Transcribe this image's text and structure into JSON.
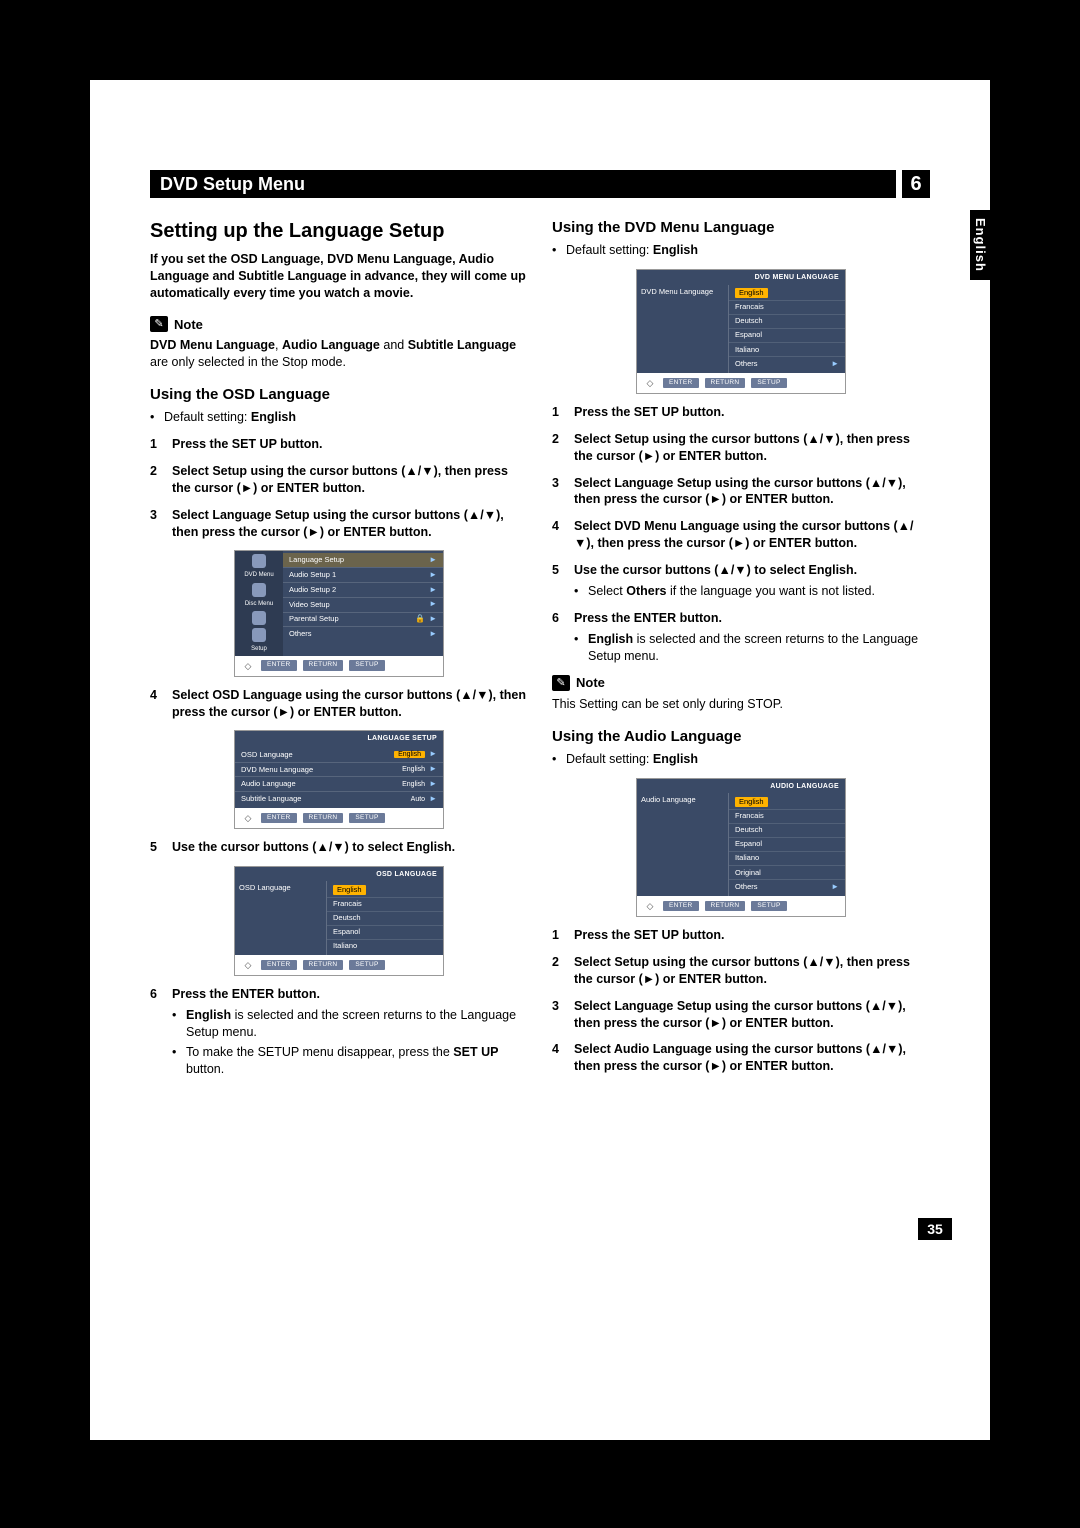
{
  "header": {
    "title": "DVD Setup Menu",
    "chapter": "6"
  },
  "side_tab": "English",
  "page_number": "35",
  "left": {
    "h2": "Setting up the Language Setup",
    "intro": "If you set the OSD Language, DVD Menu Language, Audio Language and Subtitle Language in advance, they will come up automatically every time you watch a movie.",
    "note_label": "Note",
    "note_text_pre": "DVD Menu Language",
    "note_text_mid1": ", ",
    "note_text_b2": "Audio Language",
    "note_text_mid2": " and ",
    "note_text_b3": "Subtitle Language",
    "note_text_post": " are only selected in the Stop mode.",
    "h3_osd": "Using the OSD Language",
    "default_label": "Default setting: ",
    "default_value": "English",
    "steps_osd": {
      "s1": "Press the SET UP button.",
      "s2a": "Select ",
      "s2b": "Setup",
      "s2c": " using the cursor buttons (▲/▼), then press the cursor (►) or ENTER button.",
      "s3a": "Select ",
      "s3b": "Language Setup",
      "s3c": " using the cursor buttons (▲/▼), then press the cursor (►) or ENTER button.",
      "s4a": "Select ",
      "s4b": "OSD Language",
      "s4c": " using the cursor buttons (▲/▼), then press the cursor (►) or ENTER button.",
      "s5a": "Use the cursor buttons (▲/▼) to select ",
      "s5b": "English",
      "s5c": ".",
      "s6": "Press the ENTER button.",
      "s6_b1a": "English",
      "s6_b1b": " is selected and the screen returns to the Language Setup menu.",
      "s6_b2a": "To make the SETUP menu disappear, press the ",
      "s6_b2b": "SET UP",
      "s6_b2c": " button."
    },
    "osd1": {
      "left_items": [
        "DVD Menu",
        "Disc Menu",
        "",
        "Setup"
      ],
      "rows": [
        "Language Setup",
        "Audio Setup 1",
        "Audio Setup 2",
        "Video Setup",
        "Parental Setup",
        "Others"
      ],
      "foot": [
        "ENTER",
        "RETURN",
        "SETUP"
      ]
    },
    "osd2": {
      "title": "LANGUAGE SETUP",
      "rows": [
        {
          "l": "OSD Language",
          "v": "English",
          "sel": true
        },
        {
          "l": "DVD Menu Language",
          "v": "English"
        },
        {
          "l": "Audio  Language",
          "v": "English"
        },
        {
          "l": "Subtitle  Language",
          "v": "Auto"
        }
      ],
      "foot": [
        "ENTER",
        "RETURN",
        "SETUP"
      ]
    },
    "osd3": {
      "title": "OSD LANGUAGE",
      "left_label": "OSD Language",
      "rows": [
        "English",
        "Francais",
        "Deutsch",
        "Espanol",
        "Italiano"
      ],
      "foot": [
        "ENTER",
        "RETURN",
        "SETUP"
      ]
    }
  },
  "right": {
    "h3_dvd": "Using the DVD Menu Language",
    "default_label": "Default setting: ",
    "default_value": "English",
    "osd_dvd": {
      "title": "DVD MENU LANGUAGE",
      "left_label": "DVD Menu Language",
      "rows": [
        "English",
        "Francais",
        "Deutsch",
        "Espanol",
        "Italiano",
        "Others"
      ],
      "foot": [
        "ENTER",
        "RETURN",
        "SETUP"
      ]
    },
    "steps_dvd": {
      "s1": "Press the SET UP button.",
      "s2a": "Select ",
      "s2b": "Setup",
      "s2c": " using the cursor buttons (▲/▼), then press the cursor (►) or ENTER button.",
      "s3a": "Select ",
      "s3b": "Language Setup",
      "s3c": " using the cursor buttons (▲/▼), then press the cursor (►) or ENTER button.",
      "s4a": "Select ",
      "s4b": "DVD Menu Language",
      "s4c": " using the cursor buttons (▲/▼), then press the cursor (►) or ENTER button.",
      "s5a": "Use the cursor buttons (▲/▼) to select ",
      "s5b": "English",
      "s5c": ".",
      "s5_bul_a": "Select ",
      "s5_bul_b": "Others",
      "s5_bul_c": " if the language you want is not listed.",
      "s6": "Press the ENTER button.",
      "s6_b1a": "English",
      "s6_b1b": " is selected and the screen returns to the Language Setup menu."
    },
    "note_label": "Note",
    "note_text": "This Setting can be set only during STOP.",
    "h3_audio": "Using the Audio Language",
    "osd_audio": {
      "title": "AUDIO LANGUAGE",
      "left_label": "Audio Language",
      "rows": [
        "English",
        "Francais",
        "Deutsch",
        "Espanol",
        "Italiano",
        "Original",
        "Others"
      ],
      "foot": [
        "ENTER",
        "RETURN",
        "SETUP"
      ]
    },
    "steps_audio": {
      "s1": "Press the SET UP button.",
      "s2a": "Select ",
      "s2b": "Setup",
      "s2c": " using the cursor buttons (▲/▼), then press the cursor (►) or ENTER button.",
      "s3a": "Select ",
      "s3b": "Language Setup",
      "s3c": " using the cursor buttons (▲/▼), then press the cursor (►) or ENTER button.",
      "s4a": "Select ",
      "s4b": "Audio Language",
      "s4c": " using the cursor buttons (▲/▼), then press the cursor (►) or ENTER button."
    }
  }
}
